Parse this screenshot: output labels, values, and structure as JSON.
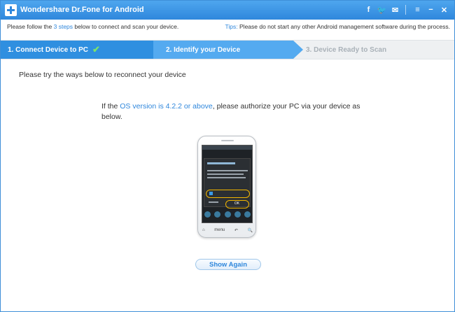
{
  "window": {
    "title": "Wondershare Dr.Fone for Android",
    "icons": [
      "facebook-icon",
      "twitter-icon",
      "chat-icon",
      "menu-icon",
      "minimize-icon",
      "close-icon"
    ]
  },
  "infobar": {
    "left_prefix": "Please follow the ",
    "left_link": "3 steps",
    "left_suffix": " below to connect and scan your device.",
    "right_label": "Tips:",
    "right_text": " Please do not start any other Android management software during the process."
  },
  "steps": [
    {
      "label": "1. Connect Device to PC",
      "state": "done"
    },
    {
      "label": "2. Identify your Device",
      "state": "active"
    },
    {
      "label": "3. Device Ready to Scan",
      "state": "pending"
    }
  ],
  "main": {
    "hint": "Please try the ways below to reconnect your device",
    "instruction_prefix": "If the ",
    "instruction_link": "OS version is 4.2.2 or above",
    "instruction_suffix": ", please authorize your PC via your device as below."
  },
  "phone": {
    "ok_label": "OK",
    "menu_label": "menu"
  },
  "button": {
    "show_again": "Show Again"
  },
  "colors": {
    "accent": "#2f87dc",
    "step_done": "#2f8fe0",
    "step_active": "#54aaf0",
    "step_pending_text": "#a9b1b8",
    "highlight": "#f2b600"
  }
}
